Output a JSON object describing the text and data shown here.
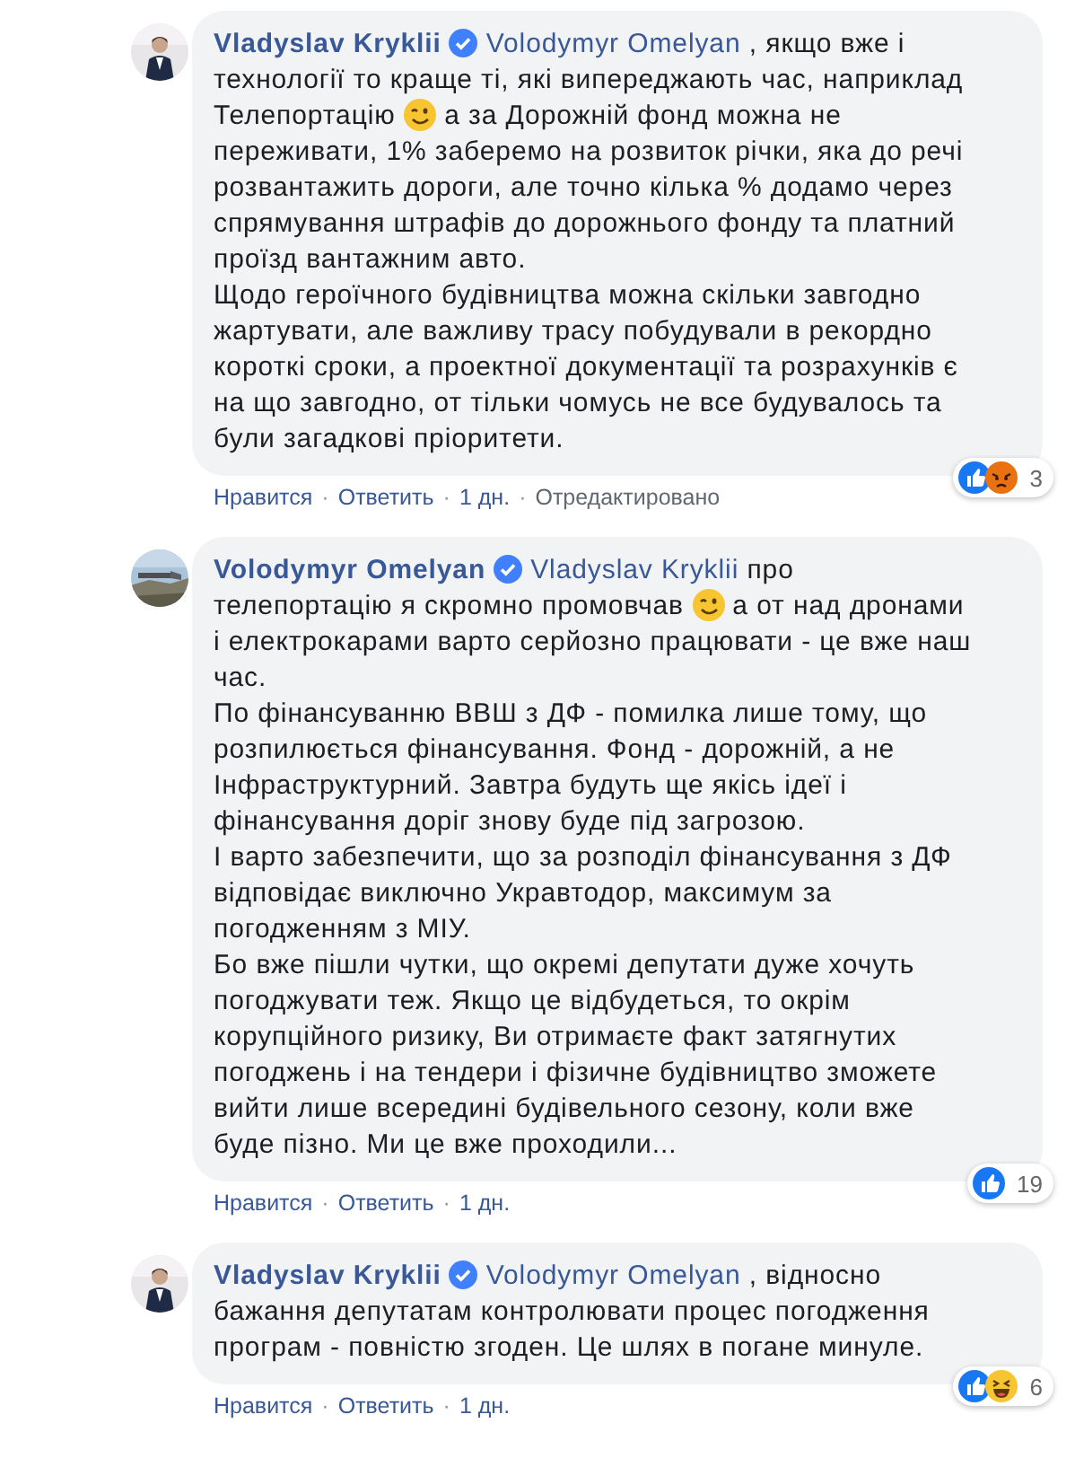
{
  "separator": "·",
  "comments": [
    {
      "author": "Vladyslav Kryklii",
      "verified": true,
      "paragraphs": [
        [
          {
            "kind": "mention",
            "text": "Volodymyr Omelyan"
          },
          {
            "kind": "text",
            "text": " , якщо вже і технології то краще ті, які випереджають час, наприклад Телепортацію "
          },
          {
            "kind": "emoji"
          },
          {
            "kind": "text",
            "text": " а за Дорожній фонд можна не переживати, 1% заберемо на розвиток річки, яка до речі розвантажить дороги, але точно кілька % додамо через спрямування штрафів до дорожнього фонду та платний проїзд вантажним авто."
          }
        ],
        [
          {
            "kind": "text",
            "text": "Щодо героїчного будівництва можна скільки завгодно жартувати, але важливу трасу побудували в рекордно короткі сроки, а проектної документації та розрахунків є на що завгодно, от тільки чомусь не все будувалось та були загадкові пріоритети."
          }
        ]
      ],
      "reactions": [
        {
          "kind": "like"
        },
        {
          "kind": "angry"
        }
      ],
      "reaction_count": "3",
      "actions": [
        {
          "kind": "link",
          "text": "Нравится"
        },
        {
          "kind": "link",
          "text": "Ответить"
        },
        {
          "kind": "time",
          "text": "1 дн."
        },
        {
          "kind": "note",
          "text": "Отредактировано"
        }
      ]
    },
    {
      "author": "Volodymyr Omelyan",
      "verified": true,
      "paragraphs": [
        [
          {
            "kind": "mention",
            "text": "Vladyslav Kryklii"
          },
          {
            "kind": "text",
            "text": " про телепортацію я скромно промовчав "
          },
          {
            "kind": "emoji"
          },
          {
            "kind": "text",
            "text": " а от над дронами і електрокарами варто серйозно працювати - це вже наш час."
          }
        ],
        [
          {
            "kind": "text",
            "text": "По фінансуванню ВВШ з ДФ - помилка лише тому, що розпилюється фінансування. Фонд - дорожній, а не Інфраструктурний. Завтра будуть ще якісь ідеї і фінансування доріг знову буде під загрозою."
          }
        ],
        [
          {
            "kind": "text",
            "text": "І варто забезпечити, що за розподіл фінансування з ДФ відповідає виключно Укравтодор, максимум за погодженням з МІУ."
          }
        ],
        [
          {
            "kind": "text",
            "text": "Бо вже пішли чутки, що окремі депутати дуже хочуть погоджувати теж. Якщо це відбудеться, то окрім корупційного ризику, Ви отримаєте факт затягнутих погоджень і на тендери і фізичне будівництво зможете вийти лише всередині будівельного сезону, коли вже буде пізно. Ми це вже проходили..."
          }
        ]
      ],
      "reactions": [
        {
          "kind": "like"
        }
      ],
      "reaction_count": "19",
      "actions": [
        {
          "kind": "link",
          "text": "Нравится"
        },
        {
          "kind": "link",
          "text": "Ответить"
        },
        {
          "kind": "time",
          "text": "1 дн."
        }
      ]
    },
    {
      "author": "Vladyslav Kryklii",
      "verified": true,
      "paragraphs": [
        [
          {
            "kind": "mention",
            "text": "Volodymyr Omelyan"
          },
          {
            "kind": "text",
            "text": " , відносно бажання депутатам контролювати процес погодження програм - повністю згоден. Це шлях в погане минуле."
          }
        ]
      ],
      "reactions": [
        {
          "kind": "like"
        },
        {
          "kind": "haha"
        }
      ],
      "reaction_count": "6",
      "actions": [
        {
          "kind": "link",
          "text": "Нравится"
        },
        {
          "kind": "link",
          "text": "Ответить"
        },
        {
          "kind": "time",
          "text": "1 дн."
        }
      ]
    }
  ]
}
